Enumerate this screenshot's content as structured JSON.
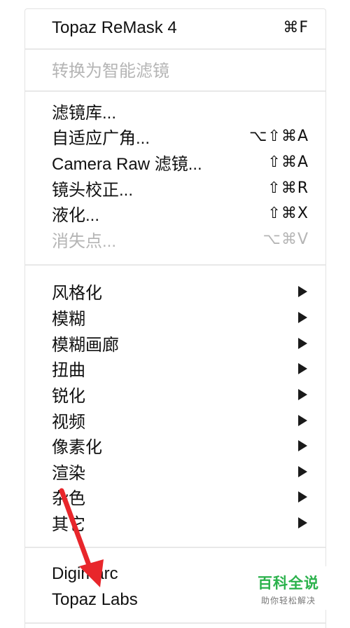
{
  "menu": {
    "top_item": {
      "label": "Topaz ReMask 4",
      "shortcut": "⌘F"
    },
    "convert_smart": {
      "label": "转换为智能滤镜"
    },
    "filters_group1": [
      {
        "label": "滤镜库...",
        "shortcut": ""
      },
      {
        "label": "自适应广角...",
        "shortcut": "⌥⇧⌘A"
      },
      {
        "label": "Camera Raw 滤镜...",
        "shortcut": "⇧⌘A"
      },
      {
        "label": "镜头校正...",
        "shortcut": "⇧⌘R"
      },
      {
        "label": "液化...",
        "shortcut": "⇧⌘X"
      },
      {
        "label": "消失点...",
        "shortcut": "⌥⌘V"
      }
    ],
    "submenus": [
      {
        "label": "风格化"
      },
      {
        "label": "模糊"
      },
      {
        "label": "模糊画廊"
      },
      {
        "label": "扭曲"
      },
      {
        "label": "锐化"
      },
      {
        "label": "视频"
      },
      {
        "label": "像素化"
      },
      {
        "label": "渲染"
      },
      {
        "label": "杂色"
      },
      {
        "label": "其它"
      }
    ],
    "plugins": [
      {
        "label": "Digimarc"
      },
      {
        "label": "Topaz Labs"
      }
    ]
  },
  "watermark": {
    "title": "百科全说",
    "subtitle": "助你轻松解决"
  },
  "colors": {
    "annotation_arrow": "#e8262b",
    "watermark_green": "#2bb24c",
    "disabled_text": "#b5b5b5"
  }
}
